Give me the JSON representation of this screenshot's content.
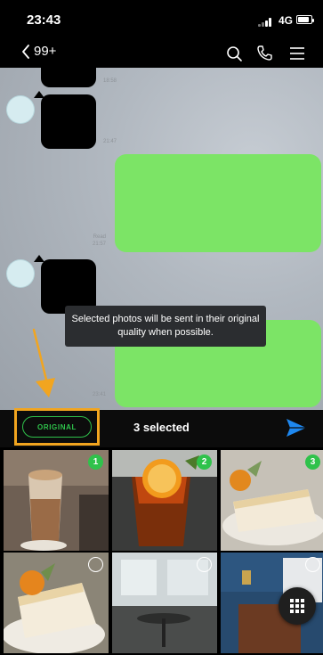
{
  "status_bar": {
    "time": "23:43",
    "network": "4G"
  },
  "header": {
    "back_count": "99+"
  },
  "chat": {
    "timestamps": [
      "18:58",
      "21:47",
      "Read\n21:57",
      "23:41"
    ],
    "toast_text": "Selected photos will be sent in their original quality when possible."
  },
  "selection_bar": {
    "original_label": "ORIGINAL",
    "selected_text": "3 selected"
  },
  "photos": [
    {
      "badge": "1",
      "selected": true
    },
    {
      "badge": "2",
      "selected": true
    },
    {
      "badge": "3",
      "selected": true
    },
    {
      "badge": "",
      "selected": false
    },
    {
      "badge": "",
      "selected": false
    },
    {
      "badge": "",
      "selected": false
    }
  ],
  "colors": {
    "accent_green": "#2fc24b",
    "bubble_green": "#7ce466",
    "highlight_orange": "#f2a51f",
    "send_blue": "#1e88f0"
  },
  "icons": [
    "back-chevron-icon",
    "search-icon",
    "phone-icon",
    "menu-icon",
    "send-icon",
    "grid-icon"
  ]
}
